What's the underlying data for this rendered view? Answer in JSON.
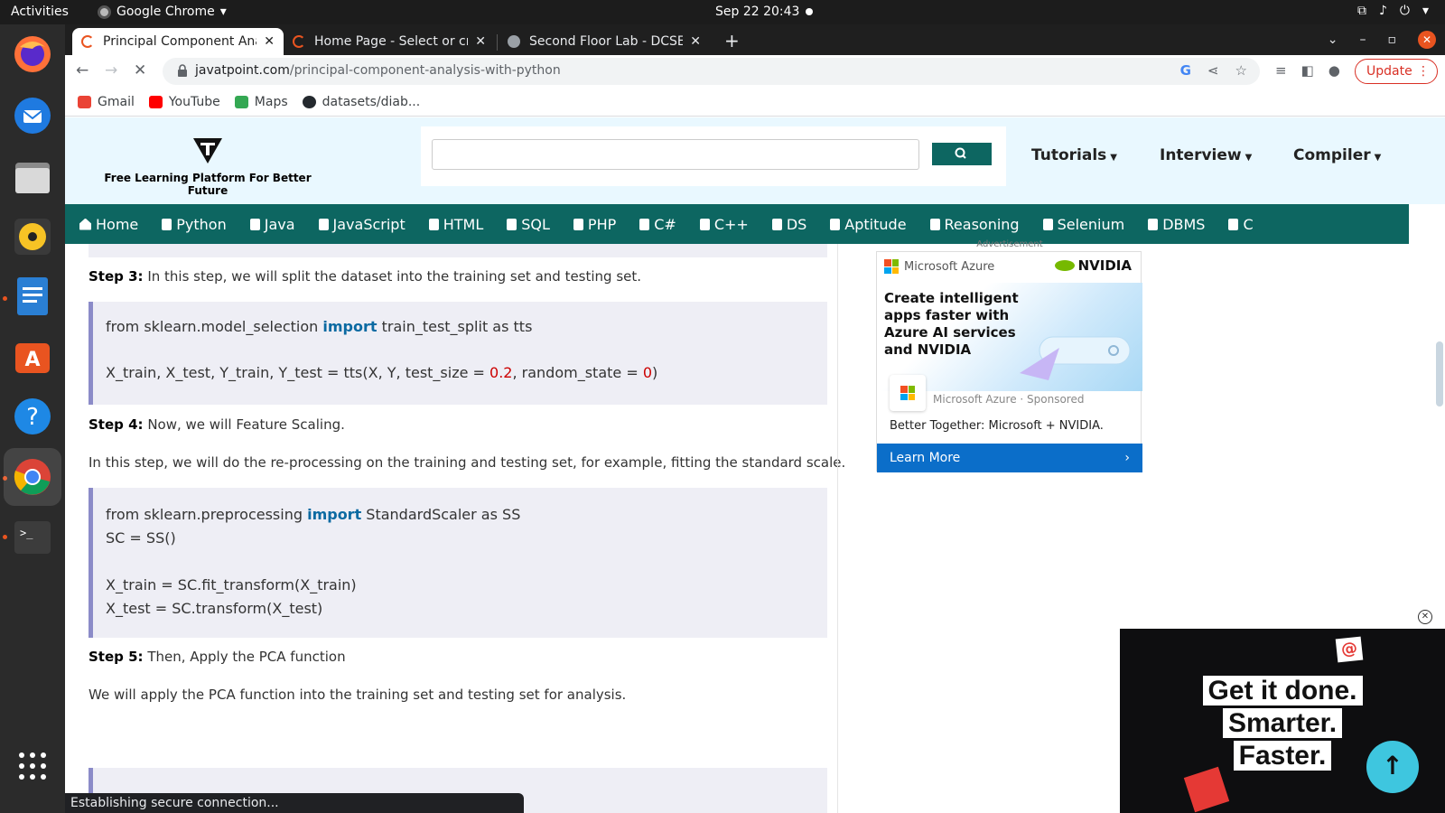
{
  "system_bar": {
    "activities": "Activities",
    "app_name": "Google Chrome",
    "datetime": "Sep 22  20:43"
  },
  "tabs": [
    {
      "title": "Principal Component Ana",
      "active": true
    },
    {
      "title": "Home Page - Select or cre",
      "active": false
    },
    {
      "title": "Second Floor Lab - DCSE",
      "active": false
    }
  ],
  "toolbar": {
    "url_domain": "javatpoint.com",
    "url_path": "/principal-component-analysis-with-python",
    "update_label": "Update"
  },
  "bookmarks": [
    {
      "label": "Gmail",
      "icon": "gmail-icon",
      "color": "#ea4335"
    },
    {
      "label": "YouTube",
      "icon": "youtube-icon",
      "color": "#ff0000"
    },
    {
      "label": "Maps",
      "icon": "maps-icon",
      "color": "#34a853"
    },
    {
      "label": "datasets/diab...",
      "icon": "github-icon",
      "color": "#24292e"
    }
  ],
  "site": {
    "tagline": "Free Learning Platform For Better Future",
    "menu": {
      "tutorials": "Tutorials",
      "interview": "Interview",
      "compiler": "Compiler"
    },
    "nav": [
      "Home",
      "Python",
      "Java",
      "JavaScript",
      "HTML",
      "SQL",
      "PHP",
      "C#",
      "C++",
      "DS",
      "Aptitude",
      "Reasoning",
      "Selenium",
      "DBMS",
      "C"
    ]
  },
  "article": {
    "step3_label": "Step 3:",
    "step3_text": " In this step, we will split the dataset into the training set and testing set.",
    "code1": {
      "l1_pre": "from sklearn.model_selection ",
      "l1_kw": "import",
      "l1_post": " train_test_split as tts",
      "l2_a": "X_train, X_test, Y_train, Y_test = tts(X, Y, test_size = ",
      "l2_n1": "0.2",
      "l2_b": ", random_state = ",
      "l2_n2": "0",
      "l2_c": ")"
    },
    "step4_label": "Step 4:",
    "step4_text": " Now, we will Feature Scaling.",
    "step4_para": "In this step, we will do the re-processing on the training and testing set, for example, fitting the standard scale.",
    "code2": {
      "l1_pre": "from sklearn.preprocessing ",
      "l1_kw": "import",
      "l1_post": " StandardScaler as SS",
      "l2": "SC = SS()",
      "l3": "X_train = SC.fit_transform(X_train)",
      "l4": "X_test = SC.transform(X_test)"
    },
    "step5_label": "Step 5:",
    "step5_text": " Then, Apply the PCA function",
    "step5_para": "We will apply the PCA function into the training set and testing set for analysis."
  },
  "ad": {
    "label": "Advertisement",
    "brand": "Microsoft Azure",
    "partner": "NVIDIA",
    "headline_1": "Create intelligent",
    "headline_2": "apps faster with",
    "headline_3": "Azure AI services",
    "headline_4": "and NVIDIA",
    "sponsor": "Microsoft Azure · Sponsored",
    "body": "Better Together: Microsoft + NVIDIA.",
    "cta": "Learn More"
  },
  "video_ad": {
    "line1": "Get it done.",
    "line2": "Smarter.",
    "line3": "Faster."
  },
  "status_text": "Establishing secure connection..."
}
